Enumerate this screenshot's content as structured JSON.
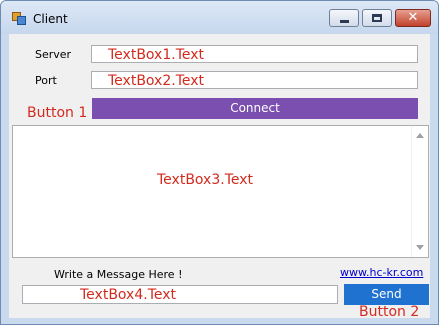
{
  "window": {
    "title": "Client",
    "minimize_icon": "minimize-icon",
    "maximize_icon": "maximize-icon",
    "close_icon": "close-icon",
    "close_glyph": "✕"
  },
  "form": {
    "server_label": "Server",
    "server_value": "TextBox1.Text",
    "port_label": "Port",
    "port_value": "TextBox2.Text",
    "button1_caption": "Button 1",
    "connect_label": "Connect",
    "messages_value": "TextBox3.Text",
    "write_label": "Write a Message Here !",
    "link_text": "www.hc-kr.com",
    "message_value": "TextBox4.Text",
    "send_label": "Send",
    "button2_caption": "Button 2"
  },
  "colors": {
    "connect_button": "#7a4fb0",
    "send_button": "#1f72d0",
    "annotation_text": "#d32a1e",
    "link": "#0000cc"
  }
}
